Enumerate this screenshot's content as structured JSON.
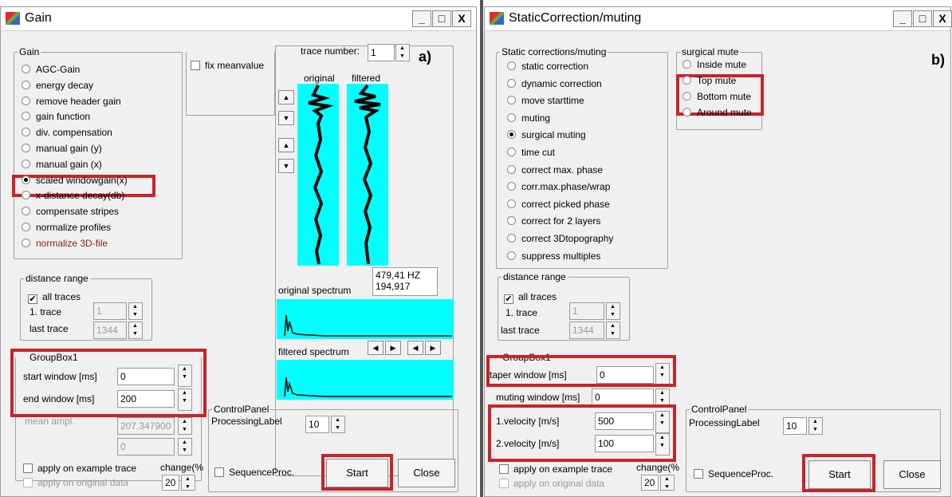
{
  "panel_a": {
    "title": "Gain",
    "letter": "a)",
    "gain_group": "Gain",
    "options": [
      "AGC-Gain",
      "energy decay",
      "remove header gain",
      "gain function",
      "div. compensation",
      "manual gain (y)",
      "manual gain (x)",
      "scaled windowgain(x)",
      "x-distance decay(db)",
      "compensate stripes",
      "normalize profiles",
      "normalize 3D-file"
    ],
    "selected": "scaled windowgain(x)",
    "fix_meanvalue": "fix meanvalue",
    "trace_number_label": "trace number:",
    "trace_number": "1",
    "original": "original",
    "filtered": "filtered",
    "freq": "479,41 HZ",
    "amp": "194,917",
    "orig_spectrum": "original spectrum",
    "filt_spectrum": "filtered spectrum",
    "distance_range": "distance range",
    "all_traces": "all traces",
    "first_trace_label": "1. trace",
    "first_trace": "1",
    "last_trace_label": "last trace",
    "last_trace": "1344",
    "groupbox": "GroupBox1",
    "start_window_label": "start window [ms]",
    "start_window": "0",
    "end_window_label": "end window [ms]",
    "end_window": "200",
    "mean_ampl_label": "mean ampl.",
    "mean_ampl": "207,347900",
    "extra_value": "0",
    "apply_example": "apply on example trace",
    "apply_original": "apply on original data",
    "change_label": "change(%",
    "change": "20",
    "control_panel": "ControlPanel",
    "processing_label": "ProcessingLabel",
    "processing_value": "10",
    "sequence_proc": "SequenceProc.",
    "start": "Start",
    "close": "Close"
  },
  "panel_b": {
    "title": "StaticCorrection/muting",
    "letter": "b)",
    "static_group": "Static corrections/muting",
    "options": [
      "static correction",
      "dynamic correction",
      "move starttime",
      "muting",
      "surgical muting",
      "time cut",
      "correct max. phase",
      "corr.max.phase/wrap",
      "correct picked phase",
      "correct for 2 layers",
      "correct 3Dtopography",
      "suppress multiples"
    ],
    "selected": "surgical muting",
    "mute_group": "surgical mute",
    "mute_options": [
      "Inside mute",
      "Top mute",
      "Bottom mute",
      "Around mute"
    ],
    "distance_range": "distance range",
    "all_traces": "all traces",
    "first_trace_label": "1. trace",
    "first_trace": "1",
    "last_trace_label": "last trace",
    "last_trace": "1344",
    "groupbox": "GroupBox1",
    "taper_window_label": "taper window [ms]",
    "taper_window": "0",
    "muting_window_label": "muting window [ms]",
    "muting_window": "0",
    "velocity1_label": "1.velocity [m/s]",
    "velocity1": "500",
    "velocity2_label": "2.velocity [m/s]",
    "velocity2": "100",
    "apply_example": "apply on example trace",
    "apply_original": "apply on original data",
    "change_label": "change(%",
    "change": "20",
    "control_panel": "ControlPanel",
    "processing_label": "ProcessingLabel",
    "processing_value": "10",
    "sequence_proc": "SequenceProc.",
    "start": "Start",
    "close": "Close"
  },
  "window_buttons": {
    "minimize": "_",
    "maximize": "□",
    "close": "X"
  },
  "colors": {
    "highlight": "#c8232c",
    "plot_bg": "#00ffff"
  }
}
